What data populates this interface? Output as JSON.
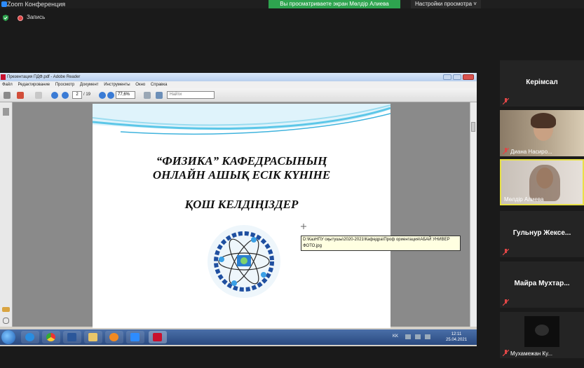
{
  "zoom": {
    "window_title": "Zoom Конференция",
    "share_banner": "Вы просматриваете экран Мөлдір Алиева",
    "view_options": "Настройки просмотра",
    "record_label": "Запись"
  },
  "reader": {
    "window_title": "Презентация ПДФ.pdf - Adobe Reader",
    "menu": [
      "Файл",
      "Редактирование",
      "Просмотр",
      "Документ",
      "Инструменты",
      "Окно",
      "Справка"
    ],
    "page_current": "2",
    "page_total": "/ 19",
    "zoom_level": "77,6%",
    "find_placeholder": "Найти"
  },
  "slide": {
    "title_line1": "“ФИЗИКА” КАФЕДРАСЫНЫҢ",
    "title_line2": "ОНЛАЙН АШЫҚ ЕСІК КҮНІНЕ",
    "welcome": "ҚОШ КЕЛДІҢІЗДЕР"
  },
  "tooltip": {
    "path": "D:\\КазНПУ оқытушы\\2020-2021\\Кафедра\\Проф ориентация\\АБАЙ УНИВЕР ФОТО.jpg"
  },
  "taskbar": {
    "lang": "KK",
    "time": "12:11",
    "date": "25.04.2021"
  },
  "participants": [
    {
      "name": "Керімсал",
      "video": false
    },
    {
      "name": "Диана Насиро...",
      "video": true
    },
    {
      "name": "Мөлдір Алиева",
      "video": true,
      "active": true
    },
    {
      "name": "Гульнур  Жексе...",
      "video": false
    },
    {
      "name": "Майра  Мухтар...",
      "video": false
    },
    {
      "name": "Мухамежан Ку...",
      "video": true
    }
  ],
  "colors": {
    "share_banner": "#2ea44f",
    "active_border": "#e7e047",
    "mic_muted": "#e04646"
  }
}
